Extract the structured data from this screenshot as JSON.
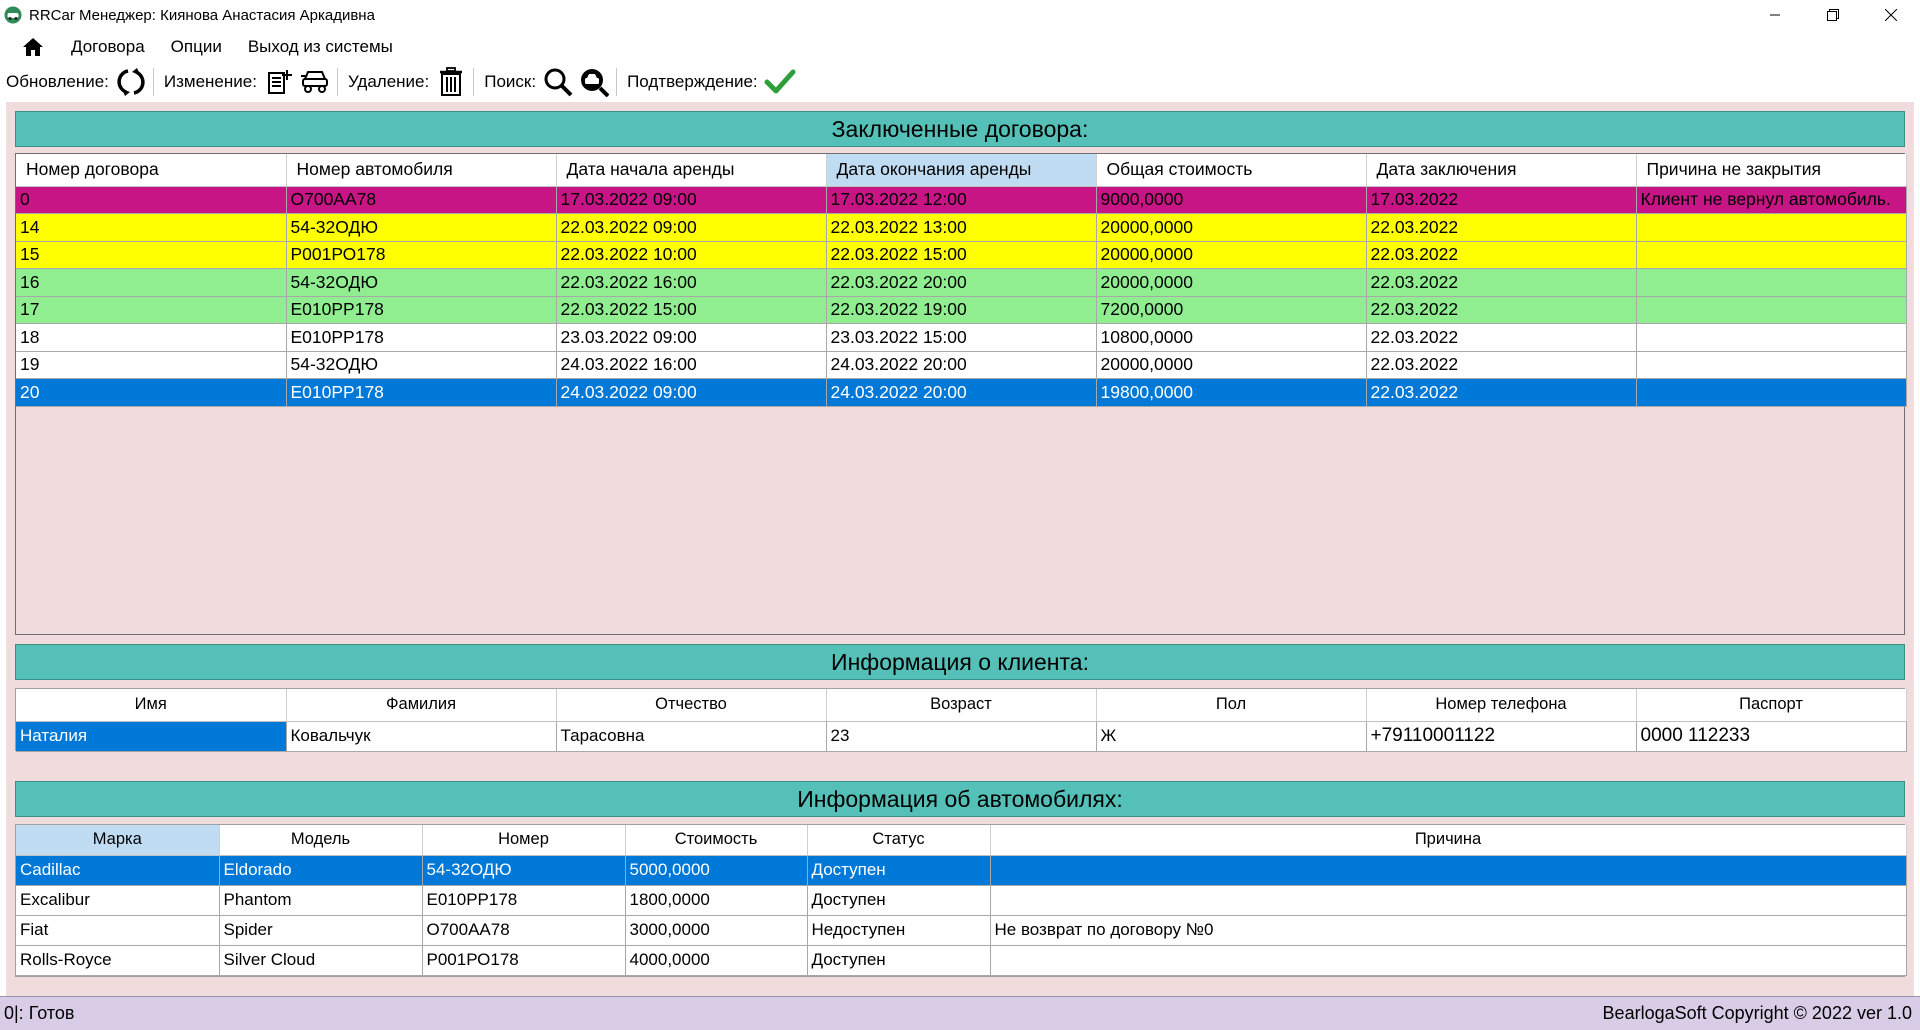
{
  "window": {
    "title": "RRCar Менеджер: Киянова Анастасия Аркадивна"
  },
  "menu": {
    "items": [
      "Договора",
      "Опции",
      "Выход из системы"
    ]
  },
  "toolbar": {
    "refresh_label": "Обновление:",
    "edit_label": "Изменение:",
    "delete_label": "Удаление:",
    "search_label": "Поиск:",
    "confirm_label": "Подтверждение:",
    "refresh_icon": "refresh-icon",
    "edit_contract_icon": "edit-contract-icon",
    "edit_car_icon": "edit-car-icon",
    "delete_icon": "trash-icon",
    "search_icon": "search-icon",
    "search_car_icon": "search-car-icon",
    "confirm_icon": "checkmark-icon"
  },
  "contracts": {
    "header": "Заключенные договора:",
    "columns": [
      "Номер договора",
      "Номер автомобиля",
      "Дата начала аренды",
      "Дата окончания аренды",
      "Общая стоимость",
      "Дата заключения",
      "Причина не закрытия"
    ],
    "rows": [
      [
        "0",
        "О700АА78",
        "17.03.2022 09:00",
        "17.03.2022 12:00",
        "9000,0000",
        "17.03.2022",
        "Клиент не вернул автомобиль."
      ],
      [
        "14",
        "54-32ОДЮ",
        "22.03.2022 09:00",
        "22.03.2022 13:00",
        "20000,0000",
        "22.03.2022",
        ""
      ],
      [
        "15",
        "Р001РО178",
        "22.03.2022 10:00",
        "22.03.2022 15:00",
        "20000,0000",
        "22.03.2022",
        ""
      ],
      [
        "16",
        "54-32ОДЮ",
        "22.03.2022 16:00",
        "22.03.2022 20:00",
        "20000,0000",
        "22.03.2022",
        ""
      ],
      [
        "17",
        "Е010РР178",
        "22.03.2022 15:00",
        "22.03.2022 19:00",
        "7200,0000",
        "22.03.2022",
        ""
      ],
      [
        "18",
        "Е010РР178",
        "23.03.2022 09:00",
        "23.03.2022 15:00",
        "10800,0000",
        "22.03.2022",
        ""
      ],
      [
        "19",
        "54-32ОДЮ",
        "24.03.2022 16:00",
        "24.03.2022 20:00",
        "20000,0000",
        "22.03.2022",
        ""
      ],
      [
        "20",
        "Е010РР178",
        "24.03.2022 09:00",
        "24.03.2022 20:00",
        "19800,0000",
        "22.03.2022",
        ""
      ]
    ],
    "row_colors": [
      "#c71585",
      "#ffff00",
      "#ffff00",
      "#90ee90",
      "#90ee90",
      "#ffffff",
      "#ffffff",
      "#0078d7"
    ]
  },
  "client": {
    "header": "Информация о клиента:",
    "columns": [
      "Имя",
      "Фамилия",
      "Отчество",
      "Возраст",
      "Пол",
      "Номер телефона",
      "Паспорт"
    ],
    "row": [
      "Наталия",
      "Ковальчук",
      "Тарасовна",
      "23",
      "Ж",
      "+79110001122",
      "0000 112233"
    ]
  },
  "cars": {
    "header": "Информация об автомобилях:",
    "columns": [
      "Марка",
      "Модель",
      "Номер",
      "Стоимость",
      "Статус",
      "Причина"
    ],
    "rows": [
      [
        "Cadillac",
        "Eldorado",
        "54-32ОДЮ",
        "5000,0000",
        "Доступен",
        ""
      ],
      [
        "Excalibur",
        "Phantom",
        "Е010РР178",
        "1800,0000",
        "Доступен",
        ""
      ],
      [
        "Fiat",
        "Spider",
        "О700АА78",
        "3000,0000",
        "Недоступен",
        "Не возврат по договору №0"
      ],
      [
        "Rolls-Royce",
        "Silver Cloud",
        "Р001РО178",
        "4000,0000",
        "Доступен",
        ""
      ]
    ]
  },
  "status": {
    "left": "0|:  Готов",
    "right": "BearlogaSoft Copyright © 2022 ver 1.0"
  },
  "colors": {
    "header_teal": "#55c0b8",
    "panel_bg": "#f0dcdc",
    "selection": "#0078d7",
    "status_bg": "#d9cce6"
  }
}
